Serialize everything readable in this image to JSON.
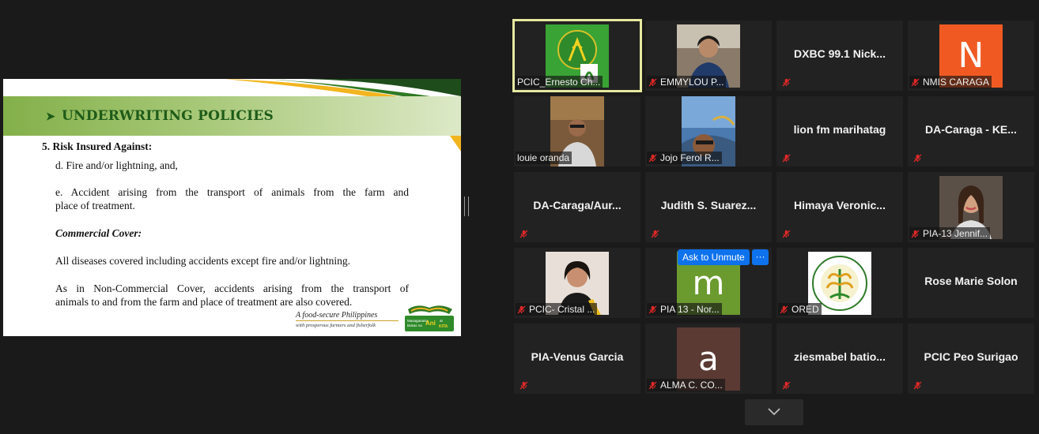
{
  "slide": {
    "title": "UNDERWRITING POLICIES",
    "heading": "5. Risk  Insured Against:",
    "item_d": "d. Fire and/or lightning, and,",
    "item_e_line1": "e. Accident arising from the transport of animals from the farm and",
    "item_e_line2": "place of treatment.",
    "commercial_heading": "Commercial Cover:",
    "commercial_text": "All diseases covered including accidents except fire and/or lightning.",
    "noncommercial_line1": "As in Non-Commercial Cover, accidents arising from the transport of",
    "noncommercial_line2": "animals to and from the farm and place of treatment are also covered.",
    "tagline": "A food-secure Philippines",
    "tagline_sub": "with prosperous farmers and fisherfolk",
    "logo_text_left": "Masaganang",
    "logo_text_mid": "Ani",
    "logo_text_right": "Mataas na Kita"
  },
  "participants": {
    "r1c1": "PCIC_Ernesto Ch...",
    "r1c2": "EMMYLOU P...",
    "r1c3": "DXBC 99.1 Nick...",
    "r1c4": "NMIS CARAGA",
    "r1c4_initial": "N",
    "r2c1": "louie oranda",
    "r2c2": "Jojo Ferol R...",
    "r2c3": "lion fm marihatag",
    "r2c4": "DA-Caraga - KE...",
    "r3c1": "DA-Caraga/Aur...",
    "r3c2": "Judith  S.  Suarez...",
    "r3c3": "Himaya  Veronic...",
    "r3c4": "PIA-13 Jennif...",
    "r4c1": "PCIC- Cristal ...",
    "r4c2": "PIA 13 - Nor...",
    "r4c2_initial": "m",
    "r4c3": "ORED",
    "r4c4": "Rose Marie Solon",
    "r5c1": "PIA-Venus Garcia",
    "r5c2": "ALMA C. CO...",
    "r5c2_initial": "a",
    "r5c3": "ziesmabel  batio...",
    "r5c4": "PCIC Peo Surigao"
  },
  "controls": {
    "ask_to_unmute": "Ask to Unmute",
    "more": "···"
  },
  "colors": {
    "muted_mic": "#e02828",
    "accent_blue": "#0e72ed",
    "nmis_orange": "#f05a22",
    "m_green": "#6b9a2f",
    "a_brown": "#5b3a33",
    "active_border": "#e6e8a0"
  }
}
